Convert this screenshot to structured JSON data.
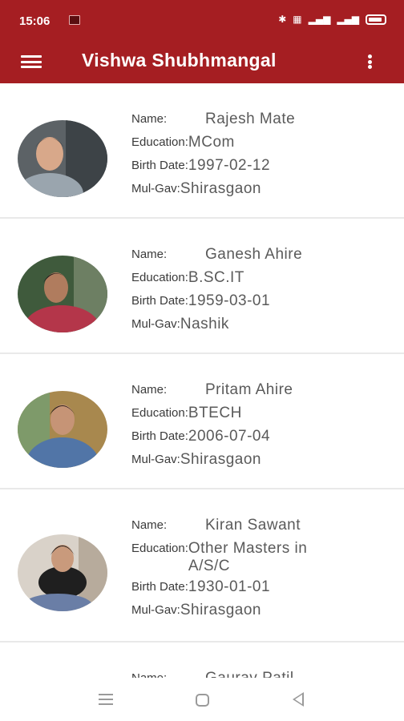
{
  "status_bar": {
    "time": "15:06",
    "icons": [
      "bluetooth-icon",
      "vibrate-icon",
      "5g-signal-icon",
      "signal-icon",
      "battery-icon"
    ],
    "network_text": "⁵ᴳ"
  },
  "app_bar": {
    "title": "Vishwa Shubhmangal",
    "menu_icon": "hamburger-menu-icon",
    "more_icon": "more-vertical-icon",
    "color": "#a51e22"
  },
  "labels": {
    "name": "Name:",
    "education": "Education:",
    "birth_date": "Birth Date:",
    "mul_gav": "Mul-Gav:"
  },
  "profiles": [
    {
      "name": "Rajesh Mate",
      "education": "MCom",
      "birth_date": "1997-02-12",
      "mul_gav": "Shirasgaon"
    },
    {
      "name": "Ganesh Ahire",
      "education": "B.SC.IT",
      "birth_date": "1959-03-01",
      "mul_gav": "Nashik"
    },
    {
      "name": "Pritam Ahire",
      "education": "BTECH",
      "birth_date": "2006-07-04",
      "mul_gav": "Shirasgaon"
    },
    {
      "name": "Kiran Sawant",
      "education": "Other Masters in A/S/C",
      "birth_date": "1930-01-01",
      "mul_gav": "Shirasgaon"
    },
    {
      "name": "Gaurav Patil"
    }
  ],
  "nav_bar": {
    "icons": [
      "recent-apps-icon",
      "home-icon",
      "back-icon"
    ]
  }
}
